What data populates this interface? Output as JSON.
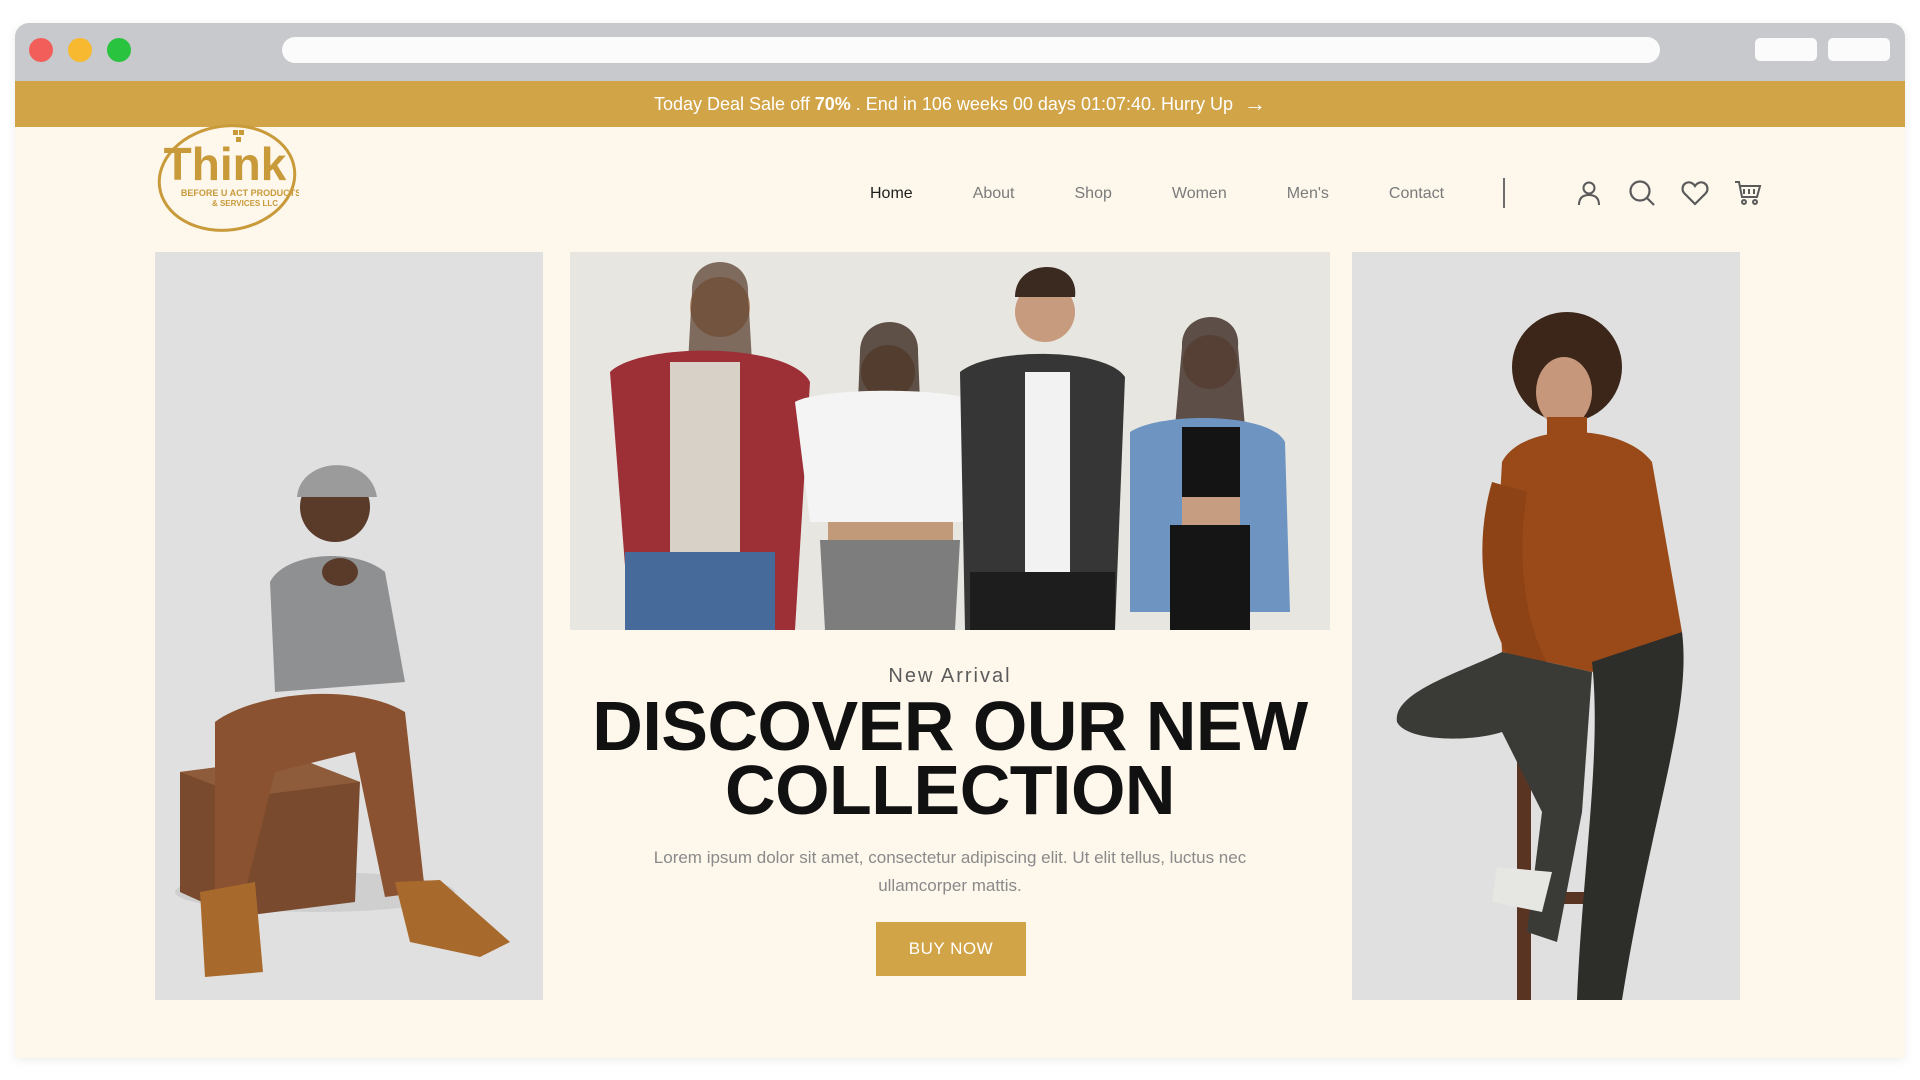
{
  "promo": {
    "lead": "Today Deal Sale off",
    "discount": "70%",
    "countdown": ". End in 106 weeks 00 days 01:07:40. Hurry Up"
  },
  "brand": {
    "logo_word": "Think",
    "logo_line1": "BEFORE U ACT PRODUCTS",
    "logo_line2": "& SERVICES LLC",
    "accent": "#d1a448"
  },
  "nav": {
    "items": [
      {
        "label": "Home",
        "active": true
      },
      {
        "label": "About"
      },
      {
        "label": "Shop"
      },
      {
        "label": "Women"
      },
      {
        "label": "Men's"
      },
      {
        "label": "Contact"
      }
    ],
    "icons": [
      "user-icon",
      "search-icon",
      "heart-icon",
      "cart-icon"
    ]
  },
  "hero": {
    "eyebrow": "New Arrival",
    "headline_line1": "DISCOVER OUR NEW",
    "headline_line2": "COLLECTION",
    "description": "Lorem ipsum dolor sit amet, consectetur adipiscing elit. Ut elit tellus, luctus nec ullamcorper mattis.",
    "cta": "BUY NOW"
  }
}
